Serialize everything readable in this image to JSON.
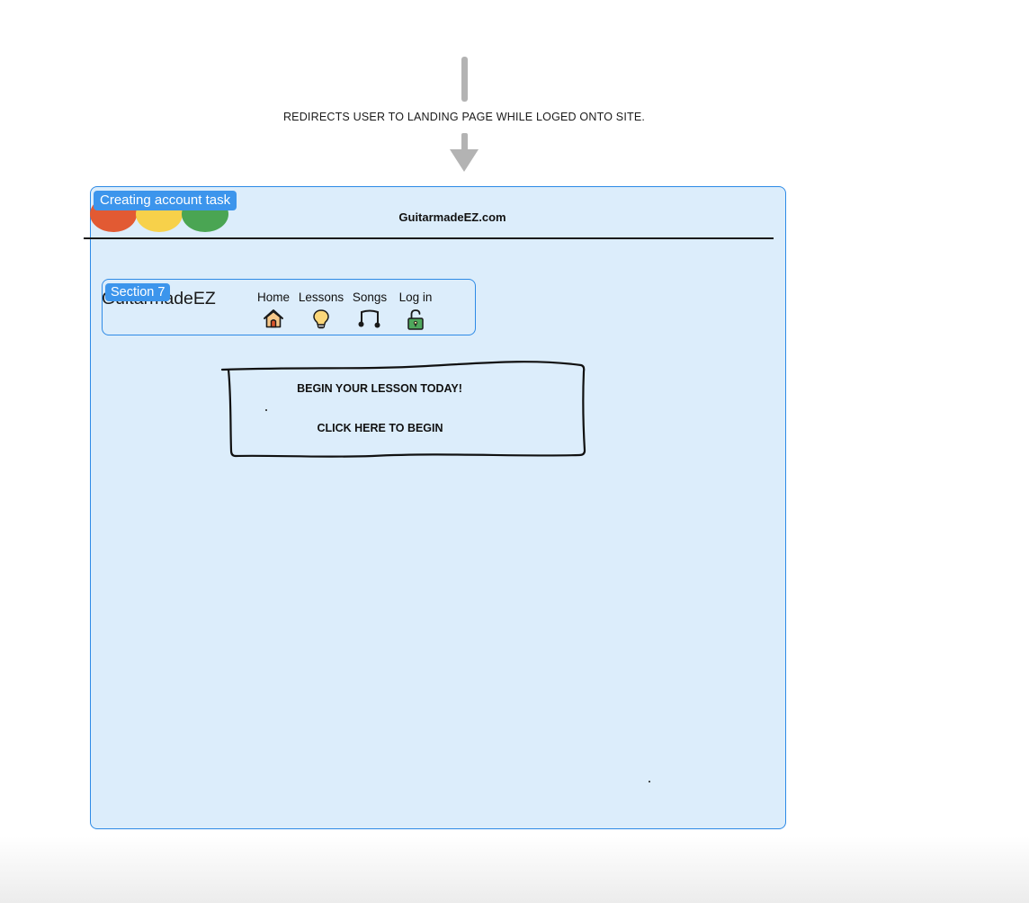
{
  "annotation": {
    "arrow_label": "REDIRECTS USER TO LANDING PAGE WHILE LOGED ONTO SITE."
  },
  "frame": {
    "tag_label": "Creating account task",
    "url": "GuitarmadeEZ.com",
    "window_dots": [
      "#e25a33",
      "#f7d14a",
      "#4aa553"
    ]
  },
  "section": {
    "tag_label": "Section 7",
    "brand": "GuitarmadeEZ"
  },
  "nav": {
    "items": [
      {
        "label": "Home",
        "icon": "house-icon"
      },
      {
        "label": "Lessons",
        "icon": "lightbulb-icon"
      },
      {
        "label": "Songs",
        "icon": "music-note-icon"
      },
      {
        "label": "Log in",
        "icon": "unlock-icon"
      }
    ]
  },
  "cta": {
    "title": "BEGIN YOUR LESSON TODAY!",
    "button_label": "CLICK HERE TO BEGIN"
  },
  "colors": {
    "frame_background": "#dcedfb",
    "frame_border": "#2d8ae6",
    "tag_background": "#3c95ec",
    "arrow": "#b3b3b3"
  }
}
